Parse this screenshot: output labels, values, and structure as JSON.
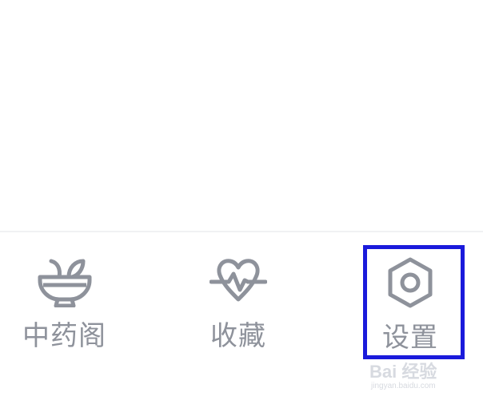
{
  "tab_bar": {
    "tabs": [
      {
        "label": "中药阁",
        "icon": "herb-bowl-icon"
      },
      {
        "label": "收藏",
        "icon": "heart-pulse-icon"
      },
      {
        "label": "设置",
        "icon": "hexagon-settings-icon"
      }
    ],
    "highlighted_tab": "设置"
  },
  "watermark": {
    "brand": "Bai 经验",
    "url": "jingyan.baidu.com"
  },
  "colors": {
    "icon_label": "#8e929b",
    "highlight_border": "#1a1adb",
    "divider": "#f0f1f3",
    "background": "#ffffff"
  }
}
